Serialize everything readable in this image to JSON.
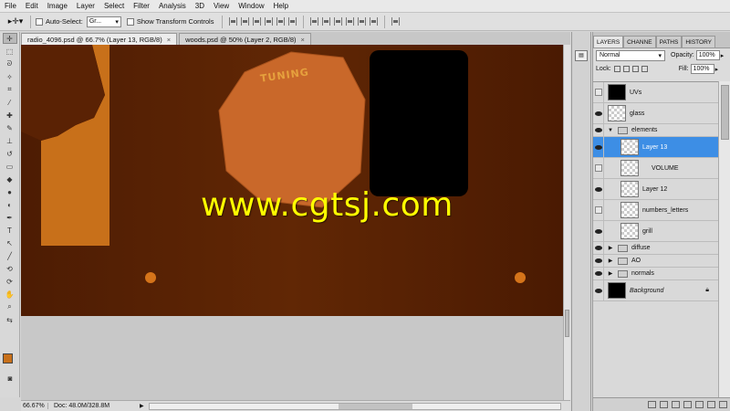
{
  "menu": [
    "File",
    "Edit",
    "Image",
    "Layer",
    "Select",
    "Filter",
    "Analysis",
    "3D",
    "View",
    "Window",
    "Help"
  ],
  "options": {
    "tool_icon": "move-tool-icon",
    "auto_select_label": "Auto-Select:",
    "auto_select_value": "Gr...",
    "transform_label": "Show Transform Controls"
  },
  "tabs": [
    {
      "label": "radio_4096.psd @ 66.7% (Layer 13, RGB/8)",
      "active": true
    },
    {
      "label": "woods.psd @ 50% (Layer 2, RGB/8)",
      "active": false
    }
  ],
  "canvas": {
    "tuning_text": "TUNING",
    "colors": {
      "wood": "#5a2204",
      "orange": "#c8701a",
      "knob": "#cd6a2a",
      "dots": "#d5741a",
      "screen": "#000000"
    }
  },
  "watermark": "www.cgtsj.com",
  "status": {
    "zoom": "66.67%",
    "doc": "Doc: 48.0M/328.8M"
  },
  "panel": {
    "tabs": [
      "LAYERS",
      "CHANNE",
      "PATHS",
      "HISTORY"
    ],
    "blend_mode": "Normal",
    "opacity_label": "Opacity:",
    "opacity_value": "100%",
    "lock_label": "Lock:",
    "fill_label": "Fill:",
    "fill_value": "100%"
  },
  "layers": [
    {
      "name": "UVs",
      "visible": false,
      "type": "layer"
    },
    {
      "name": "glass",
      "visible": true,
      "type": "layer"
    },
    {
      "name": "elements",
      "visible": true,
      "type": "group-open"
    },
    {
      "name": "Layer 13",
      "visible": true,
      "type": "layer",
      "selected": true,
      "indent": true
    },
    {
      "name": "VOLUME",
      "visible": false,
      "type": "layer",
      "indent": true
    },
    {
      "name": "Layer 12",
      "visible": true,
      "type": "layer",
      "indent": true
    },
    {
      "name": "numbers_letters",
      "visible": false,
      "type": "layer",
      "indent": true
    },
    {
      "name": "grill",
      "visible": true,
      "type": "layer",
      "indent": true
    },
    {
      "name": "diffuse",
      "visible": true,
      "type": "group"
    },
    {
      "name": "AO",
      "visible": true,
      "type": "group"
    },
    {
      "name": "normals",
      "visible": true,
      "type": "group"
    },
    {
      "name": "Background",
      "visible": true,
      "type": "background"
    }
  ]
}
